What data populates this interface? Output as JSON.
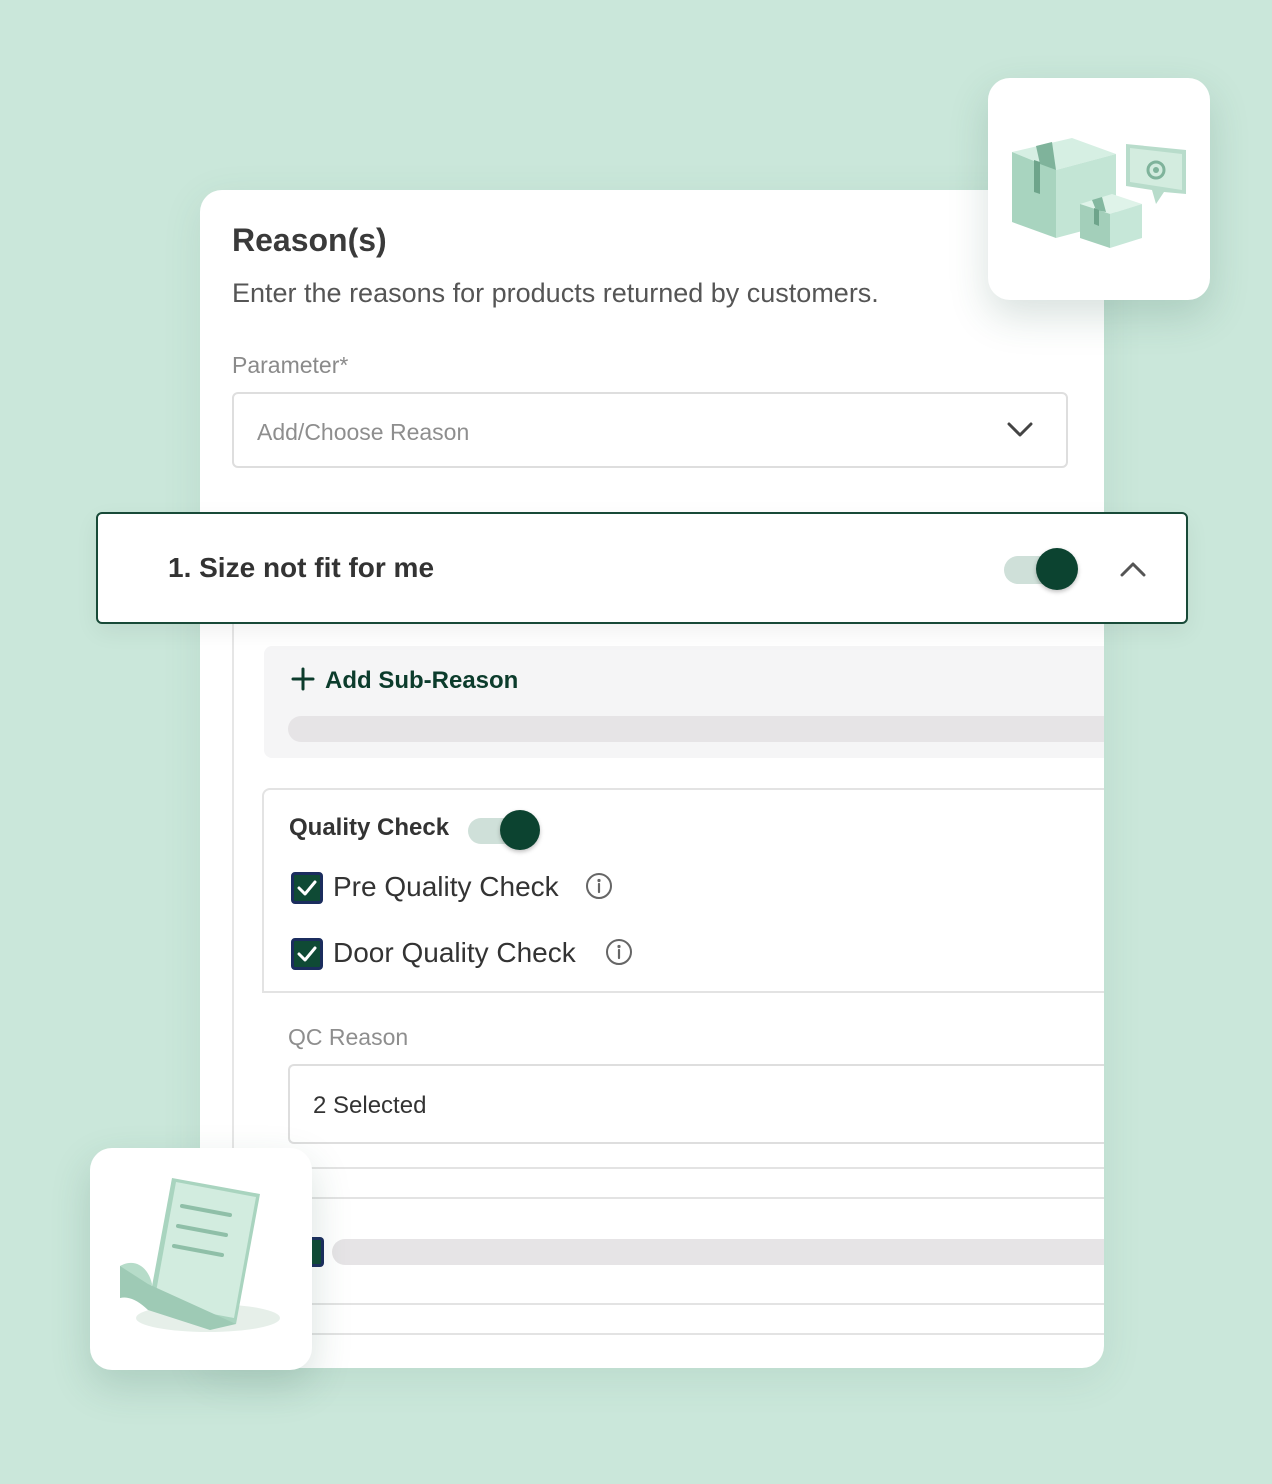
{
  "card": {
    "title": "Reason(s)",
    "subtitle": "Enter the reasons for products returned by customers.",
    "parameter_label": "Parameter*",
    "parameter_placeholder": "Add/Choose Reason"
  },
  "reason": {
    "label": "1. Size not fit for me",
    "enabled": true,
    "expanded": true
  },
  "sub_reason": {
    "add_label": "Add Sub-Reason"
  },
  "quality_check": {
    "title": "Quality Check",
    "enabled": true,
    "options": [
      {
        "label": "Pre Quality Check",
        "checked": true
      },
      {
        "label": "Door Quality Check",
        "checked": true
      }
    ],
    "qc_reason_label": "QC Reason",
    "qc_reason_value": "2 Selected"
  },
  "colors": {
    "background": "#cae7da",
    "accent_dark_green": "#0c4330",
    "toggle_track": "#cfe0d9",
    "row_border": "#184a38"
  },
  "icons": {
    "dropdown": "chevron-down-icon",
    "collapse": "chevron-up-icon",
    "add": "plus-icon",
    "info": "info-icon",
    "boxes_tile": "boxes-icon",
    "document_tile": "document-icon"
  }
}
